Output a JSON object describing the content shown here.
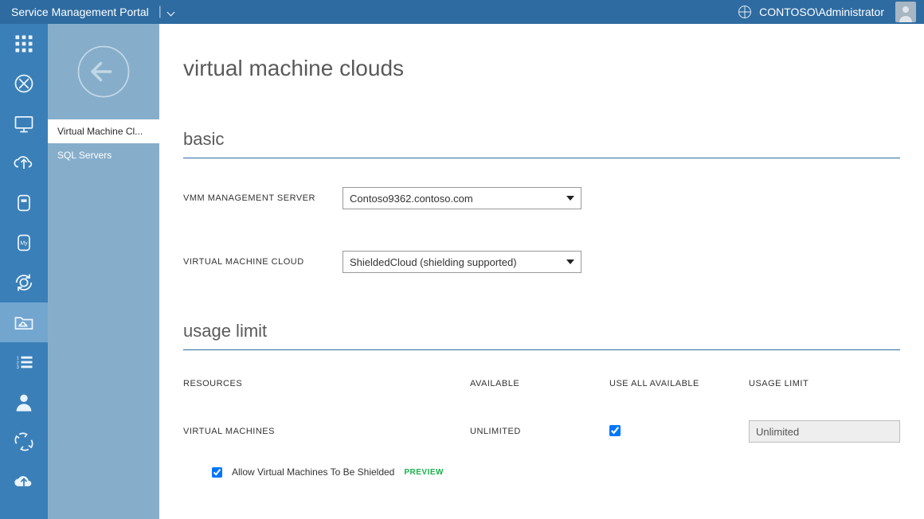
{
  "app": {
    "title": "Service Management Portal"
  },
  "user": {
    "display": "CONTOSO\\Administrator"
  },
  "sidebar": {
    "items": [
      {
        "label": "Virtual Machine Cl...",
        "active": true
      },
      {
        "label": "SQL Servers",
        "active": false
      }
    ]
  },
  "page": {
    "title": "virtual machine clouds"
  },
  "sections": {
    "basic": {
      "title": "basic",
      "fields": {
        "vmm_server": {
          "label": "VMM MANAGEMENT SERVER",
          "selected": "Contoso9362.contoso.com"
        },
        "vm_cloud": {
          "label": "VIRTUAL MACHINE CLOUD",
          "selected": "ShieldedCloud (shielding supported)"
        }
      }
    },
    "usage": {
      "title": "usage limit",
      "headers": {
        "resources": "RESOURCES",
        "available": "AVAILABLE",
        "use_all": "USE ALL AVAILABLE",
        "usage_limit": "USAGE LIMIT"
      },
      "rows": [
        {
          "resource": "VIRTUAL MACHINES",
          "available": "UNLIMITED",
          "use_all_checked": true,
          "usage_limit_value": "Unlimited"
        }
      ],
      "shield_option": {
        "checked": true,
        "label": "Allow Virtual Machines To Be Shielded",
        "badge": "PREVIEW"
      }
    }
  },
  "rail": {
    "items": [
      {
        "name": "grid-icon",
        "active": false
      },
      {
        "name": "browser-icon",
        "active": false
      },
      {
        "name": "monitor-icon",
        "active": false
      },
      {
        "name": "upload-cloud-icon",
        "active": false
      },
      {
        "name": "database-icon",
        "active": false
      },
      {
        "name": "mysql-icon",
        "active": false
      },
      {
        "name": "gear-refresh-icon",
        "active": false
      },
      {
        "name": "cloud-folder-icon",
        "active": true
      },
      {
        "name": "list-icon",
        "active": false
      },
      {
        "name": "person-icon",
        "active": false
      },
      {
        "name": "recycle-icon",
        "active": false
      },
      {
        "name": "cloud-up-icon",
        "active": false
      }
    ]
  }
}
